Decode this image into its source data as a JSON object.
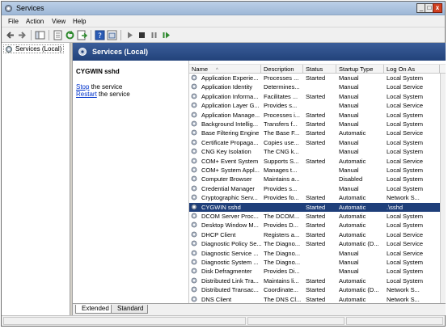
{
  "window": {
    "title": "Services"
  },
  "menu": [
    "File",
    "Action",
    "View",
    "Help"
  ],
  "toolbar": {
    "buttons": [
      "back-arrow-icon",
      "forward-arrow-icon",
      "up-level-icon",
      "show-hide-tree-icon",
      "refresh-icon",
      "export-list-icon",
      "help-icon",
      "properties-icon",
      "start-icon",
      "stop-icon",
      "pause-icon",
      "restart-icon"
    ]
  },
  "tree": {
    "root_label": "Services (Local)"
  },
  "panel": {
    "header": "Services (Local)",
    "selected_service": "CYGWIN sshd",
    "stop_link": "Stop",
    "stop_suffix": " the service",
    "restart_link": "Restart",
    "restart_suffix": " the service"
  },
  "list": {
    "columns": [
      "Name",
      "Description",
      "Status",
      "Startup Type",
      "Log On As"
    ],
    "sort_indicator": "^",
    "rows": [
      {
        "name": "Application Experie...",
        "desc": "Processes ...",
        "status": "Started",
        "startup": "Manual",
        "logon": "Local System"
      },
      {
        "name": "Application Identity",
        "desc": "Determines...",
        "status": "",
        "startup": "Manual",
        "logon": "Local Service"
      },
      {
        "name": "Application Informa...",
        "desc": "Facilitates ...",
        "status": "Started",
        "startup": "Manual",
        "logon": "Local System"
      },
      {
        "name": "Application Layer G...",
        "desc": "Provides s...",
        "status": "",
        "startup": "Manual",
        "logon": "Local Service"
      },
      {
        "name": "Application Manage...",
        "desc": "Processes i...",
        "status": "Started",
        "startup": "Manual",
        "logon": "Local System"
      },
      {
        "name": "Background Intellig...",
        "desc": "Transfers f...",
        "status": "Started",
        "startup": "Manual",
        "logon": "Local System"
      },
      {
        "name": "Base Filtering Engine",
        "desc": "The Base F...",
        "status": "Started",
        "startup": "Automatic",
        "logon": "Local Service"
      },
      {
        "name": "Certificate Propaga...",
        "desc": "Copies use...",
        "status": "Started",
        "startup": "Manual",
        "logon": "Local System"
      },
      {
        "name": "CNG Key Isolation",
        "desc": "The CNG k...",
        "status": "",
        "startup": "Manual",
        "logon": "Local System"
      },
      {
        "name": "COM+ Event System",
        "desc": "Supports S...",
        "status": "Started",
        "startup": "Automatic",
        "logon": "Local Service"
      },
      {
        "name": "COM+ System Appl...",
        "desc": "Manages t...",
        "status": "",
        "startup": "Manual",
        "logon": "Local System"
      },
      {
        "name": "Computer Browser",
        "desc": "Maintains a...",
        "status": "",
        "startup": "Disabled",
        "logon": "Local System"
      },
      {
        "name": "Credential Manager",
        "desc": "Provides s...",
        "status": "",
        "startup": "Manual",
        "logon": "Local System"
      },
      {
        "name": "Cryptographic Serv...",
        "desc": "Provides fo...",
        "status": "Started",
        "startup": "Automatic",
        "logon": "Network S..."
      },
      {
        "name": "CYGWIN sshd",
        "desc": "",
        "status": "Started",
        "startup": "Automatic",
        "logon": ".\\sshd",
        "selected": true
      },
      {
        "name": "DCOM Server Proc...",
        "desc": "The DCOM...",
        "status": "Started",
        "startup": "Automatic",
        "logon": "Local System"
      },
      {
        "name": "Desktop Window M...",
        "desc": "Provides D...",
        "status": "Started",
        "startup": "Automatic",
        "logon": "Local System"
      },
      {
        "name": "DHCP Client",
        "desc": "Registers a...",
        "status": "Started",
        "startup": "Automatic",
        "logon": "Local Service"
      },
      {
        "name": "Diagnostic Policy Se...",
        "desc": "The Diagno...",
        "status": "Started",
        "startup": "Automatic (D...",
        "logon": "Local Service"
      },
      {
        "name": "Diagnostic Service ...",
        "desc": "The Diagno...",
        "status": "",
        "startup": "Manual",
        "logon": "Local Service"
      },
      {
        "name": "Diagnostic System ...",
        "desc": "The Diagno...",
        "status": "",
        "startup": "Manual",
        "logon": "Local System"
      },
      {
        "name": "Disk Defragmenter",
        "desc": "Provides Di...",
        "status": "",
        "startup": "Manual",
        "logon": "Local System"
      },
      {
        "name": "Distributed Link Tra...",
        "desc": "Maintains li...",
        "status": "Started",
        "startup": "Automatic",
        "logon": "Local System"
      },
      {
        "name": "Distributed Transac...",
        "desc": "Coordinate...",
        "status": "Started",
        "startup": "Automatic (D...",
        "logon": "Network S..."
      },
      {
        "name": "DNS Client",
        "desc": "The DNS Cl...",
        "status": "Started",
        "startup": "Automatic",
        "logon": "Network S..."
      }
    ]
  },
  "tabs": [
    "Extended",
    "Standard"
  ]
}
